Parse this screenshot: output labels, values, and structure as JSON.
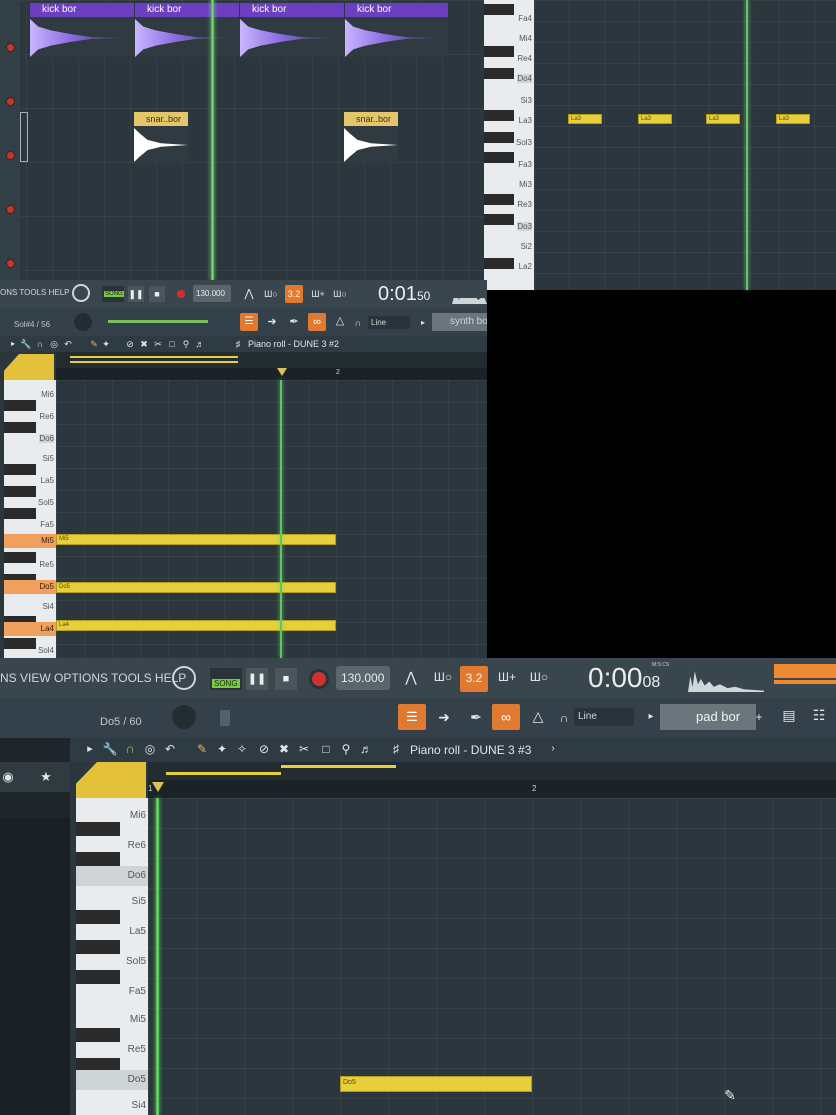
{
  "playlist": {
    "kick_clips": [
      "kick bor",
      "kick bor",
      "kick bor",
      "kick bor"
    ],
    "snare_clips": [
      "snar..bor",
      "snar..bor"
    ]
  },
  "top_piano_roll": {
    "key_labels": [
      "Fa4",
      "Mi4",
      "Re4",
      "Do4",
      "Si3",
      "La3",
      "Sol3",
      "Fa3",
      "Mi3",
      "Re3",
      "Do3",
      "Si2",
      "La2"
    ],
    "note_label": "La3",
    "notes": [
      "La3",
      "La3",
      "La3",
      "La3"
    ]
  },
  "transport_1": {
    "menu": "ONS TOOLS HELP",
    "song_label": "SONG",
    "tempo": "130.000",
    "time_main": "0:01",
    "time_sub": "50",
    "snap_label": "Line",
    "channel": "synth bo",
    "key_info": "Sol#4 / 56"
  },
  "piano_roll_1": {
    "title": "Piano roll - DUNE 3 #2",
    "bar_marker": "2",
    "key_labels": [
      "Mi6",
      "Re6",
      "Do6",
      "Si5",
      "La5",
      "Sol5",
      "Fa5",
      "Mi5",
      "Re5",
      "Do5",
      "Si4",
      "La4",
      "Sol4"
    ],
    "notes": [
      "Mi5",
      "Do5",
      "La4"
    ]
  },
  "transport_2": {
    "menu": "NS VIEW OPTIONS TOOLS HELP",
    "song_label": "SONG",
    "tempo": "130.000",
    "time_main": "0:00",
    "time_sub": "08",
    "time_unit": "M:S:CS",
    "snap_label": "Line",
    "channel": "pad bor",
    "key_info": "Do5 / 60"
  },
  "piano_roll_2": {
    "title": "Piano roll - DUNE 3 #3",
    "bar_marker_1": "1",
    "bar_marker_2": "2",
    "key_labels": [
      "Mi6",
      "Re6",
      "Do6",
      "Si5",
      "La5",
      "Sol5",
      "Fa5",
      "Mi5",
      "Re5",
      "Do5",
      "Si4"
    ],
    "note": "Do5"
  },
  "colors": {
    "accent": "#e07a30",
    "note": "#e6cf3a",
    "kick": "#6b3fc0",
    "playhead": "#6fd06f"
  }
}
